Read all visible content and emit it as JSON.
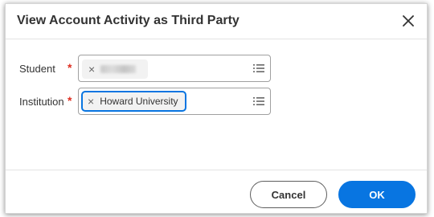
{
  "dialog": {
    "title": "View Account Activity as Third Party",
    "close_icon": "close-icon"
  },
  "fields": {
    "student": {
      "label": "Student",
      "required_mark": "*",
      "value_redacted": true,
      "remove_symbol": "×",
      "list_icon": "list-icon"
    },
    "institution": {
      "label": "Institution",
      "required_mark": "*",
      "value": "Howard University",
      "remove_symbol": "×",
      "list_icon": "list-icon"
    }
  },
  "buttons": {
    "cancel": "Cancel",
    "ok": "OK"
  },
  "colors": {
    "primary": "#0875e1",
    "required": "#de2e21",
    "text": "#333333"
  }
}
